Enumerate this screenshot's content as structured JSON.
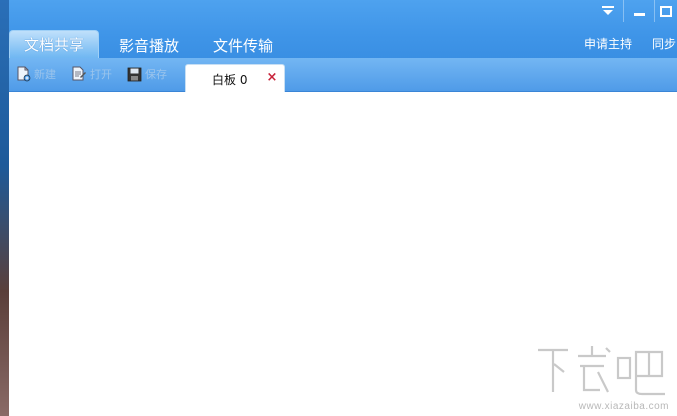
{
  "window": {
    "controls": [
      {
        "name": "dropdown-icon"
      },
      {
        "name": "minimize-icon"
      },
      {
        "name": "maximize-icon"
      }
    ]
  },
  "tabs": [
    {
      "label": "文档共享",
      "active": true
    },
    {
      "label": "影音播放",
      "active": false
    },
    {
      "label": "文件传输",
      "active": false
    }
  ],
  "right_actions": {
    "request_host": "申请主持",
    "sync": "同步"
  },
  "toolbar": {
    "new_label": "新建",
    "open_label": "打开",
    "save_label": "保存"
  },
  "document_tab": {
    "label": "白板 0",
    "close": "×"
  },
  "watermark": {
    "brand": "下载吧",
    "url": "www.xiazaiba.com"
  },
  "colors": {
    "title_blue": "#3f95e8",
    "toolbar_blue": "#5fa8ee",
    "close_red": "#c8233a"
  }
}
